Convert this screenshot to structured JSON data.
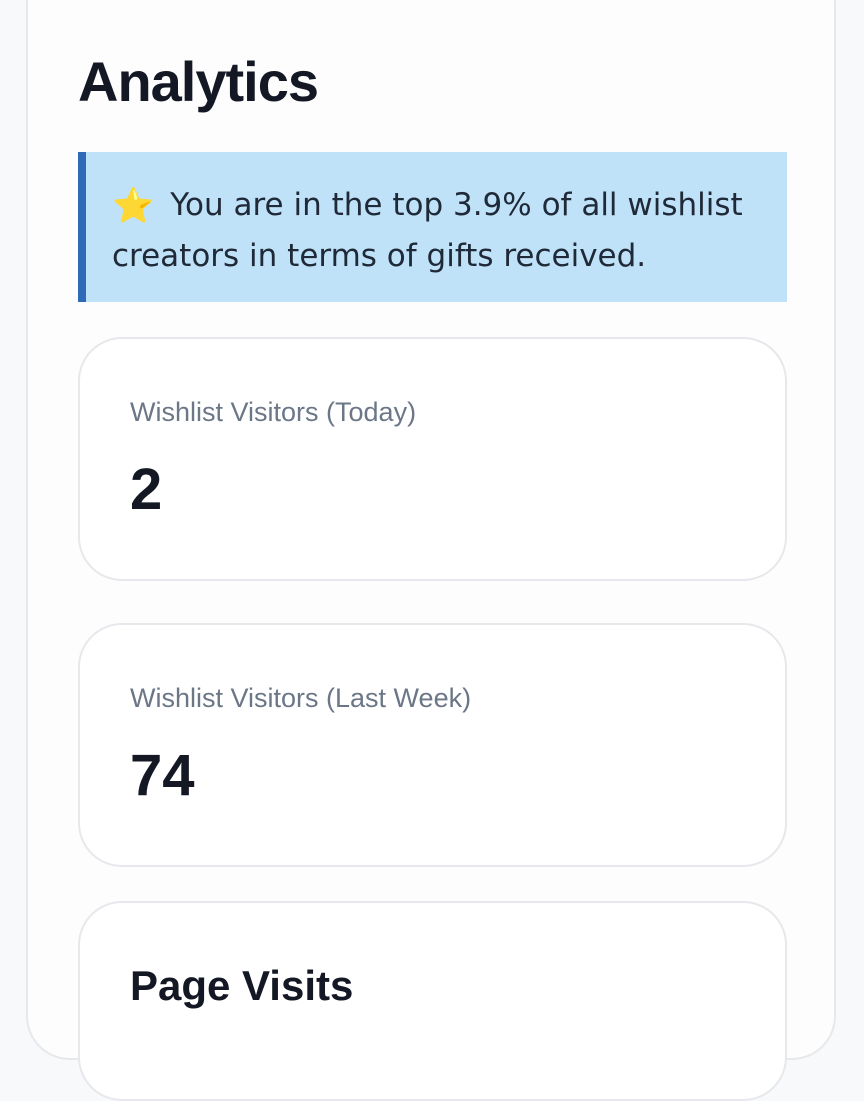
{
  "page": {
    "title": "Analytics"
  },
  "banner": {
    "icon": "star-icon",
    "icon_glyph": "⭐",
    "text": "You are in the top 3.9% of all wishlist creators in terms of gifts received."
  },
  "stats": [
    {
      "label": "Wishlist Visitors (Today)",
      "value": "2"
    },
    {
      "label": "Wishlist Visitors (Last Week)",
      "value": "74"
    }
  ],
  "page_visits": {
    "title": "Page Visits"
  },
  "colors": {
    "banner_background": "#bfe2f8",
    "banner_accent": "#2f6ab8",
    "label_gray": "#6b7787"
  }
}
